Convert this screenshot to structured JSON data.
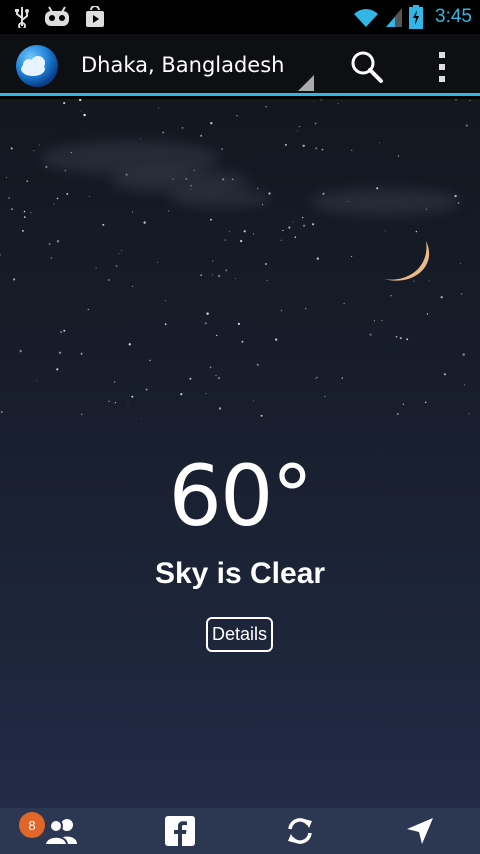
{
  "status_bar": {
    "time": "3:45",
    "icons": [
      "usb-icon",
      "android-debug-icon",
      "play-store-icon",
      "wifi-icon",
      "signal-icon",
      "battery-charging-icon"
    ]
  },
  "action_bar": {
    "location": "Dhaka, Bangladesh",
    "icons": [
      "app-logo-icon",
      "search-icon",
      "overflow-menu-icon"
    ]
  },
  "weather": {
    "temperature": "60°",
    "condition": "Sky is Clear",
    "details_label": "Details"
  },
  "bottom_nav": {
    "friends_badge": "8",
    "items": [
      "friends-icon",
      "facebook-icon",
      "refresh-icon",
      "location-arrow-icon"
    ]
  },
  "colors": {
    "accent": "#33b5e5",
    "badge": "#e0662a",
    "bottom_bar": "#2c3752"
  }
}
